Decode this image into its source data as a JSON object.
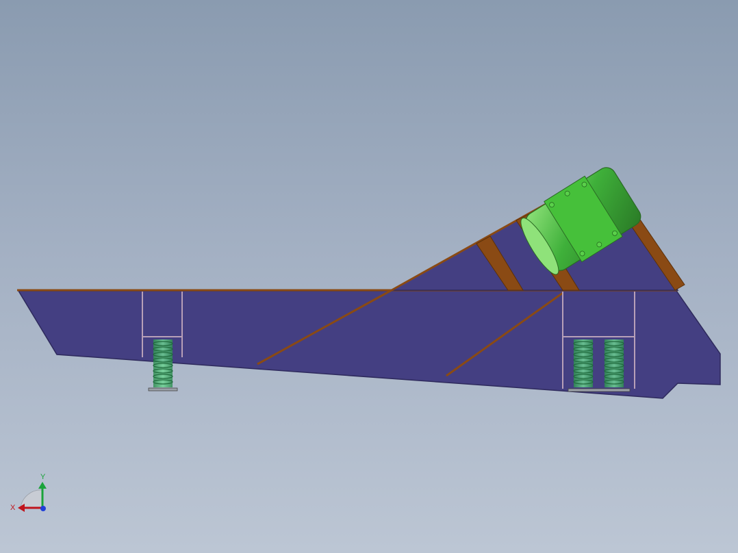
{
  "colors": {
    "background_top": "#8a9bb0",
    "background_bottom": "#bcc6d4",
    "frame_body": "#443f82",
    "frame_edge": "#2e2a5c",
    "brace_brown": "#8a4a14",
    "brace_brown_dark": "#5c3008",
    "motor_green": "#3fb03a",
    "motor_green_light": "#7fd86a",
    "spring_green": "#3fae68",
    "axis_x": "#c0141c",
    "axis_y": "#1aa33a",
    "axis_z": "#1f3fd8"
  },
  "triad": {
    "x_label": "X",
    "y_label": "Y"
  },
  "icons": {
    "coordinate_triad": "xyz-axis-triad-icon",
    "vibration_motor": "motor-cylinder",
    "springs": "coil-spring"
  }
}
